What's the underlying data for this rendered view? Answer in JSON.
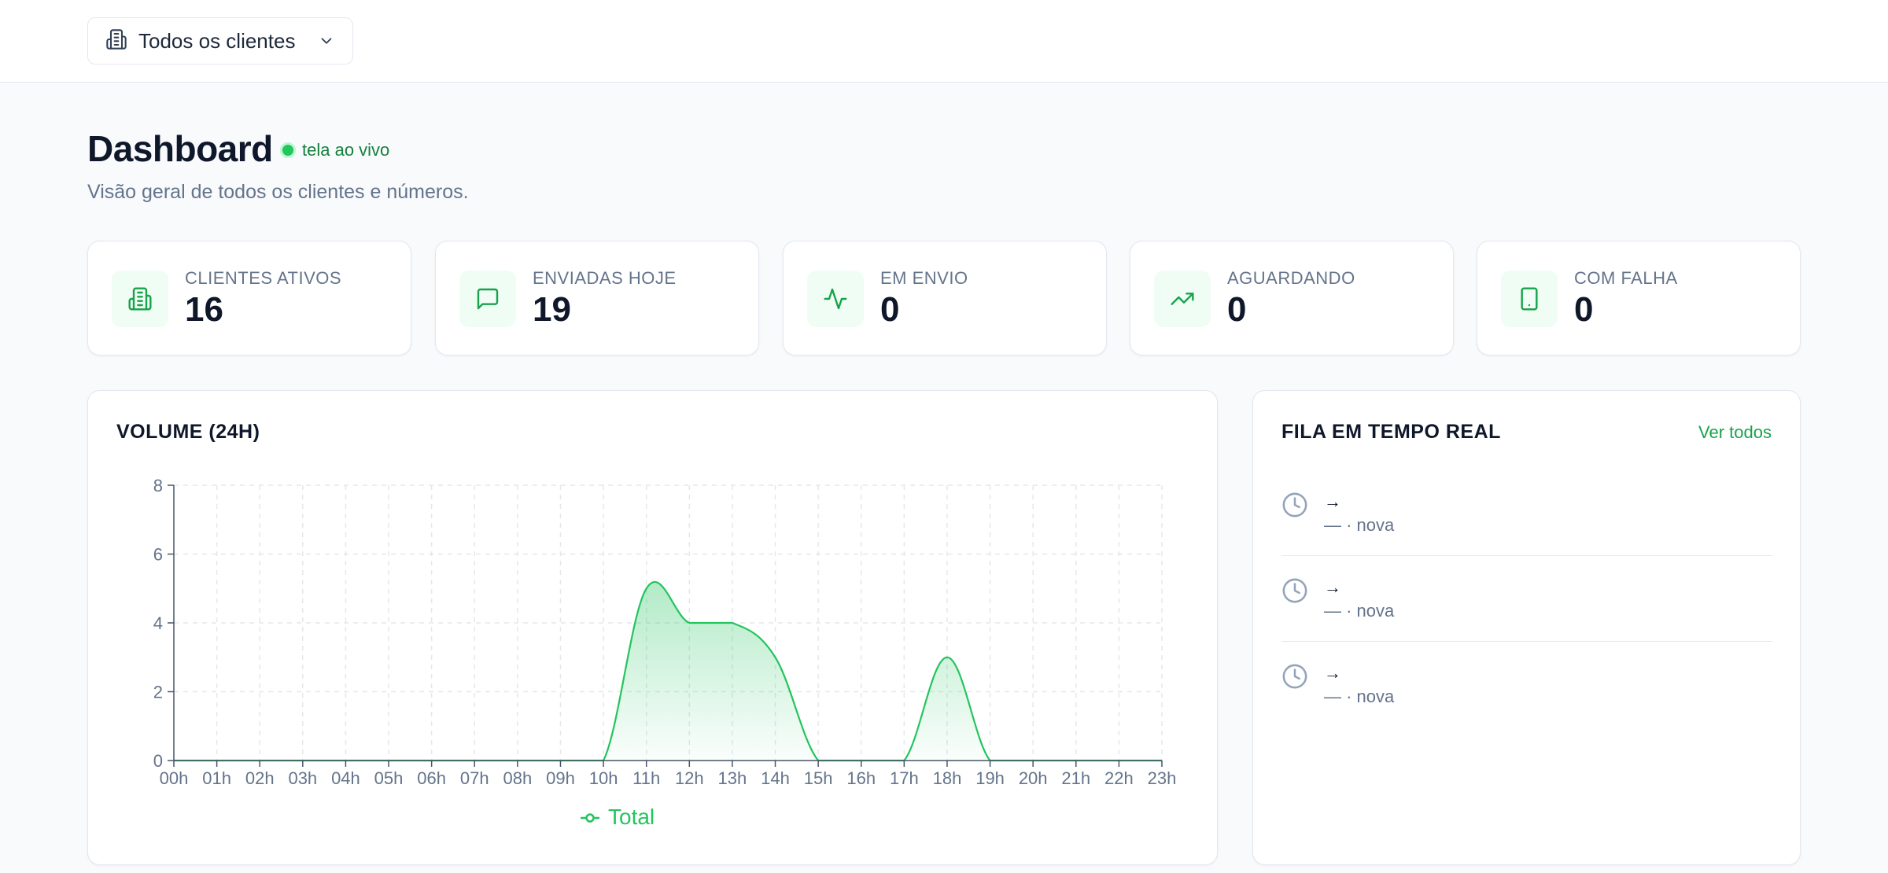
{
  "topbar": {
    "client_select": {
      "label": "Todos os clientes",
      "icon": "building-icon"
    }
  },
  "header": {
    "title": "Dashboard",
    "live_label": "tela ao vivo",
    "subtitle": "Visão geral de todos os clientes e números."
  },
  "stats": [
    {
      "label": "CLIENTES ATIVOS",
      "value": "16",
      "icon": "building-icon"
    },
    {
      "label": "ENVIADAS HOJE",
      "value": "19",
      "icon": "message-icon"
    },
    {
      "label": "EM ENVIO",
      "value": "0",
      "icon": "activity-icon"
    },
    {
      "label": "AGUARDANDO",
      "value": "0",
      "icon": "trending-up-icon"
    },
    {
      "label": "COM FALHA",
      "value": "0",
      "icon": "smartphone-icon"
    }
  ],
  "volume": {
    "title": "VOLUME (24H)"
  },
  "queue": {
    "title": "FILA EM TEMPO REAL",
    "see_all": "Ver todos",
    "items": [
      {
        "route": "→",
        "meta": "— · nova"
      },
      {
        "route": "→",
        "meta": "— · nova"
      },
      {
        "route": "→",
        "meta": "— · nova"
      }
    ]
  },
  "colors": {
    "accent": "#22c55e",
    "accent_dark": "#16a34a",
    "grid": "#e5e7eb"
  },
  "chart_data": {
    "type": "area",
    "categories": [
      "00h",
      "01h",
      "02h",
      "03h",
      "04h",
      "05h",
      "06h",
      "07h",
      "08h",
      "09h",
      "10h",
      "11h",
      "12h",
      "13h",
      "14h",
      "15h",
      "16h",
      "17h",
      "18h",
      "19h",
      "20h",
      "21h",
      "22h",
      "23h"
    ],
    "series": [
      {
        "name": "Total",
        "values": [
          0,
          0,
          0,
          0,
          0,
          0,
          0,
          0,
          0,
          0,
          0,
          5,
          4,
          4,
          3,
          0,
          0,
          0,
          3,
          0,
          0,
          0,
          0,
          0
        ]
      }
    ],
    "yticks": [
      0,
      2,
      4,
      6,
      8
    ],
    "ylim": [
      0,
      8
    ],
    "grid": true,
    "legend": "bottom-center"
  }
}
